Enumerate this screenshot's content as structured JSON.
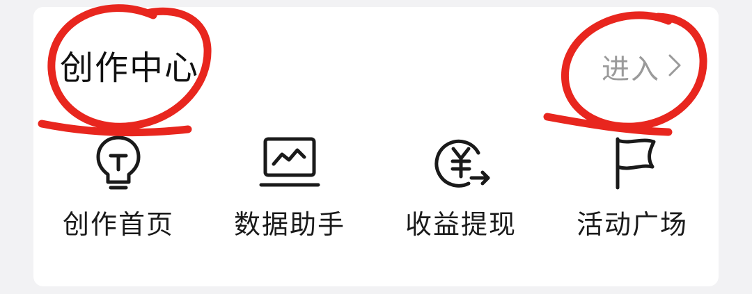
{
  "card": {
    "title": "创作中心",
    "enter_label": "进入"
  },
  "entries": [
    {
      "label": "创作首页",
      "icon": "lightbulb-icon"
    },
    {
      "label": "数据助手",
      "icon": "chart-monitor-icon"
    },
    {
      "label": "收益提现",
      "icon": "yuan-withdraw-icon"
    },
    {
      "label": "活动广场",
      "icon": "flag-icon"
    }
  ],
  "colors": {
    "title": "#111111",
    "enter": "#9a9a9a",
    "annotation": "#e8261e",
    "card_bg": "#ffffff",
    "page_bg": "#f2f2f4"
  }
}
